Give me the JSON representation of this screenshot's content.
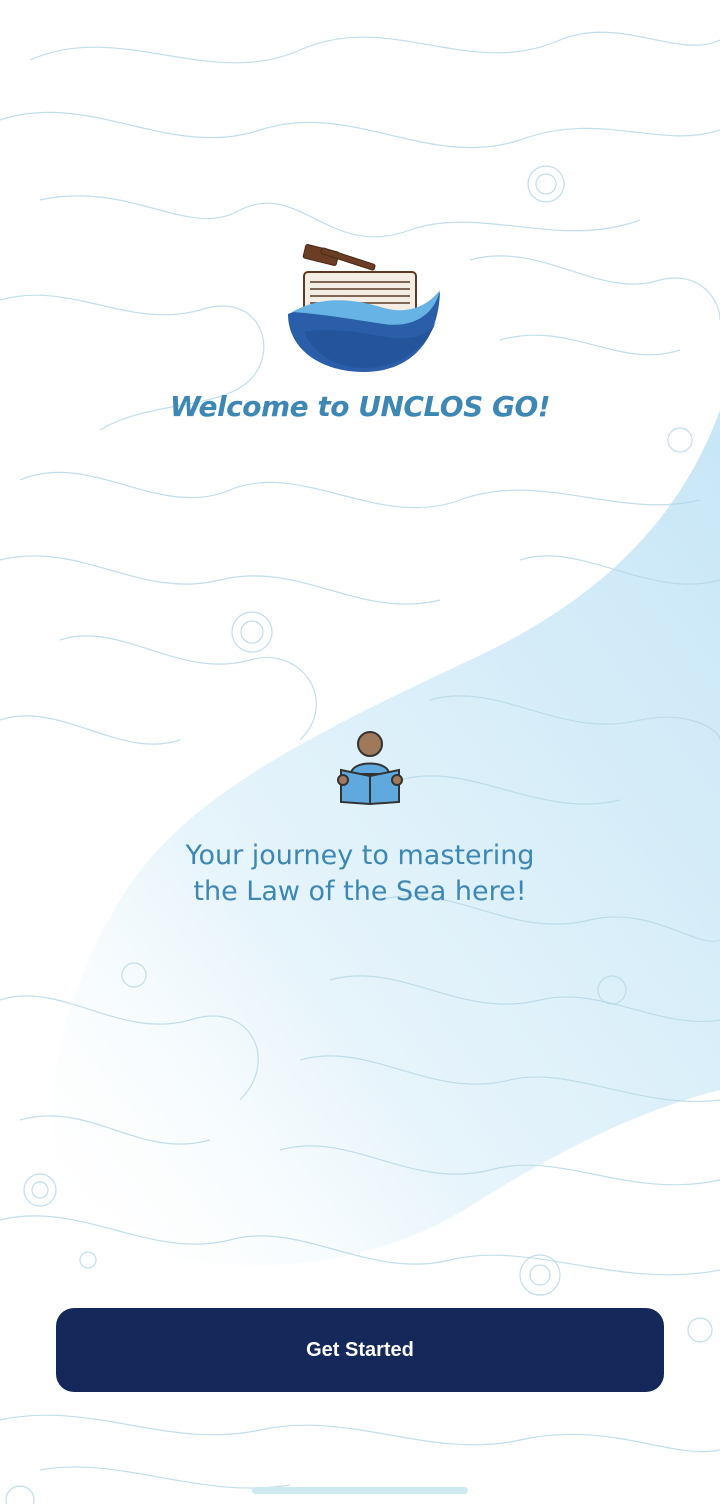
{
  "welcome": {
    "title": "Welcome to UNCLOS GO!",
    "logo_icon": "gavel-book-wave-logo",
    "reader_icon": "person-reading-book-icon"
  },
  "tagline": {
    "line1": "Your journey to mastering",
    "line2": "the Law of the Sea here!"
  },
  "actions": {
    "get_started_label": "Get Started"
  },
  "colors": {
    "title_text": "#3d87b5",
    "button_bg": "#15285a",
    "button_text": "#ffffff",
    "wave_light": "#cde9f7",
    "logo_blue_dark": "#2b5ea8",
    "logo_blue_light": "#68b3e6",
    "contour_lines": "#b9d8e6"
  }
}
